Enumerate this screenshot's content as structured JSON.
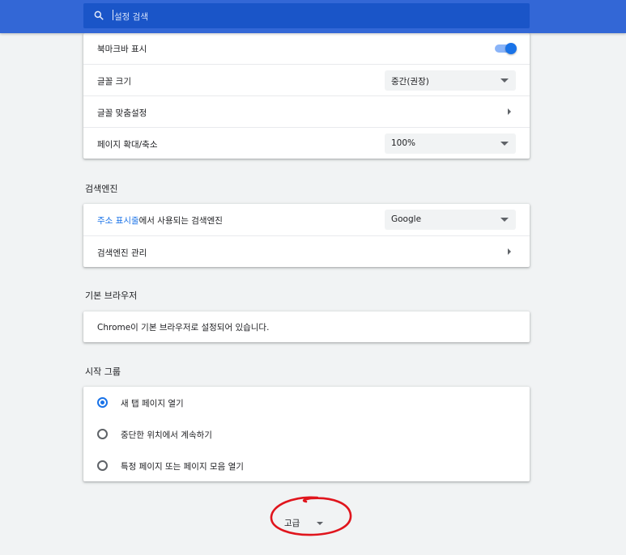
{
  "search": {
    "placeholder": "설정 검색"
  },
  "appearance": {
    "bookmark_bar": {
      "label": "북마크바 표시",
      "enabled": true
    },
    "font_size": {
      "label": "글꼴 크기",
      "value": "중간(권장)"
    },
    "customize_fonts": {
      "label": "글꼴 맞춤설정"
    },
    "page_zoom": {
      "label": "페이지 확대/축소",
      "value": "100%"
    }
  },
  "search_engine": {
    "title": "검색엔진",
    "address_bar": {
      "link": "주소 표시줄",
      "label": "에서 사용되는 검색엔진",
      "value": "Google"
    },
    "manage": {
      "label": "검색엔진 관리"
    }
  },
  "default_browser": {
    "title": "기본 브라우저",
    "text": "Chrome이 기본 브라우저로 설정되어 있습니다."
  },
  "on_startup": {
    "title": "시작 그룹",
    "options": [
      {
        "label": "새 탭 페이지 열기",
        "checked": true
      },
      {
        "label": "중단한 위치에서 계속하기",
        "checked": false
      },
      {
        "label": "특정 페이지 또는 페이지 모음 열기",
        "checked": false
      }
    ]
  },
  "advanced": {
    "label": "고급"
  },
  "colors": {
    "accent": "#1a73e8",
    "header": "#3367d6",
    "annotation": "#e0151d"
  }
}
